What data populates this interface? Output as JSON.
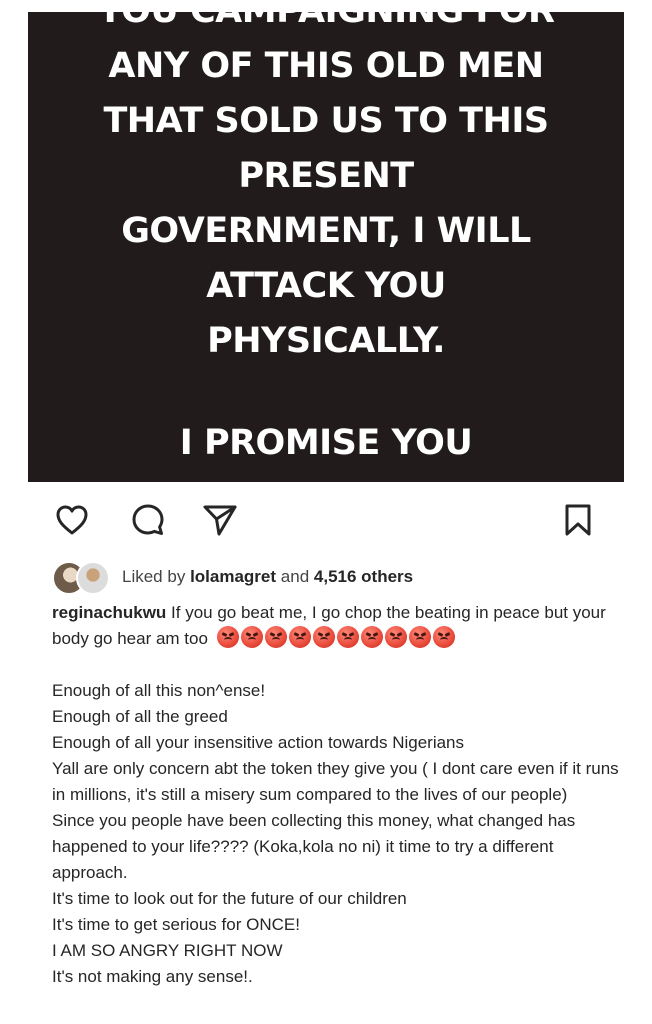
{
  "post": {
    "image_text": {
      "cut_top_line": "YOU CAMPAIGNING FOR",
      "lines": [
        "ANY OF THIS OLD MEN",
        "THAT SOLD US TO THIS",
        "PRESENT",
        "GOVERNMENT, I WILL",
        "ATTACK YOU",
        "PHYSICALLY."
      ],
      "closing": "I PROMISE YOU"
    },
    "image_background": "#211b1b"
  },
  "actions": {
    "like_icon": "heart-icon",
    "comment_icon": "comment-icon",
    "share_icon": "paper-plane-icon",
    "save_icon": "bookmark-icon"
  },
  "likes": {
    "prefix": "Liked by",
    "user": "lolamagret",
    "conjunction": "and",
    "count": "4,516 others"
  },
  "caption": {
    "username": "reginachukwu",
    "first_text": "If you go beat me, I go chop the beating in peace but your body go hear am too",
    "emoji_count": 10,
    "emoji_name": "angry-face-emoji",
    "paragraphs": [
      "Enough of all this non^ense!",
      "Enough of all the greed",
      "Enough of all your insensitive action towards Nigerians",
      "Yall are only concern abt the token they give you ( I dont care even if it runs in millions, it's still a misery sum compared to the lives of our people)",
      "Since you people have been collecting this money, what changed has happened to your life???? (Koka,kola no ni) it time to try a different approach.",
      "It's time to look out for the future of our children",
      "It's time to get serious for ONCE!",
      "I AM SO ANGRY RIGHT NOW",
      "It's not making any sense!."
    ]
  }
}
